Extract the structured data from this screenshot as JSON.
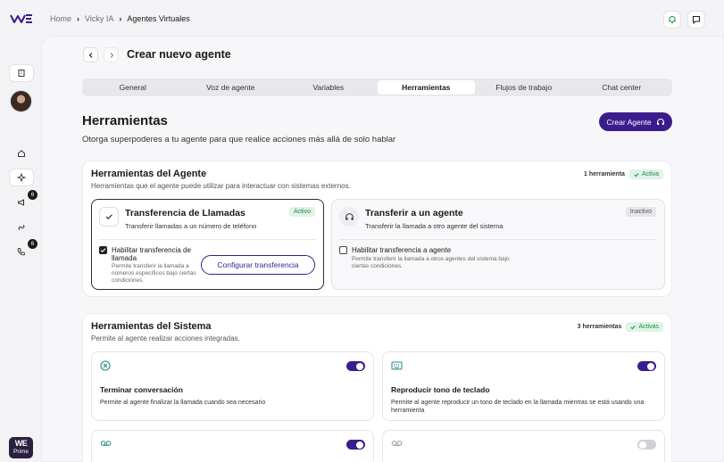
{
  "breadcrumb": [
    "Home",
    "Vicky IA",
    "Agentes Virtuales"
  ],
  "sidebar": {
    "badges": {
      "megaphone": "6",
      "phone": "6"
    },
    "prime": {
      "logo": "WE",
      "label": "Prime"
    }
  },
  "header": {
    "title": "Crear nuevo agente"
  },
  "tabs": [
    {
      "label": "General",
      "active": false
    },
    {
      "label": "Voz de agente",
      "active": false
    },
    {
      "label": "Variables",
      "active": false
    },
    {
      "label": "Herramientas",
      "active": true
    },
    {
      "label": "Flujos de trabajo",
      "active": false
    },
    {
      "label": "Chat center",
      "active": false
    }
  ],
  "page": {
    "heading": "Herramientas",
    "subtitle": "Otorga superpoderes a tu agente para que realice acciones más allá de solo hablar",
    "create_button": "Crear Agente"
  },
  "agent_tools": {
    "title": "Herramientas del Agente",
    "subtitle": "Herramientas que el agente puede utilizar para interactuar con sistemas externos.",
    "count": "1 herramienta",
    "status": "Activa",
    "items": [
      {
        "name": "Transferencia de Llamadas",
        "description": "Transferir llamadas a un número de teléfono",
        "tag": "Activo",
        "checkbox_label": "Habilitar transferencia de llamada",
        "checkbox_help": "Permite transferir la llamada a números específicos bajo ciertas condiciones.",
        "checked": true,
        "config_button": "Configurar transferencia",
        "icon": "check-icon"
      },
      {
        "name": "Transferir a un agente",
        "description": "Transferir la llamada a otro agente del sistema",
        "tag": "Inactivo",
        "checkbox_label": "Habilitar transferencia a agente",
        "checkbox_help": "Permite transferir la llamada a otros agentes del sistema bajo ciertas condiciones.",
        "checked": false,
        "icon": "headset-icon"
      }
    ]
  },
  "system_tools": {
    "title": "Herramientas del Sistema",
    "subtitle": "Permite al agente realizar acciones integradas.",
    "count": "3 herramientas",
    "status": "Activas",
    "items": [
      {
        "name": "Terminar conversación",
        "description": "Permite al agente finalizar la llamada cuando sea necesario",
        "enabled": true,
        "icon": "circle-x-icon"
      },
      {
        "name": "Reproducir tono de teclado",
        "description": "Permite al agente reproducir un tono de teclado en la llamada mientras se está usando una herramienta",
        "enabled": true,
        "icon": "keyboard-icon"
      },
      {
        "name": "",
        "description": "",
        "enabled": true,
        "icon": "voicemail-icon"
      },
      {
        "name": "",
        "description": "",
        "enabled": false,
        "icon": "voicemail-icon"
      }
    ]
  },
  "colors": {
    "accent": "#3b1c8c",
    "success": "#1f8a4a",
    "success_bg": "#dff3e6"
  }
}
